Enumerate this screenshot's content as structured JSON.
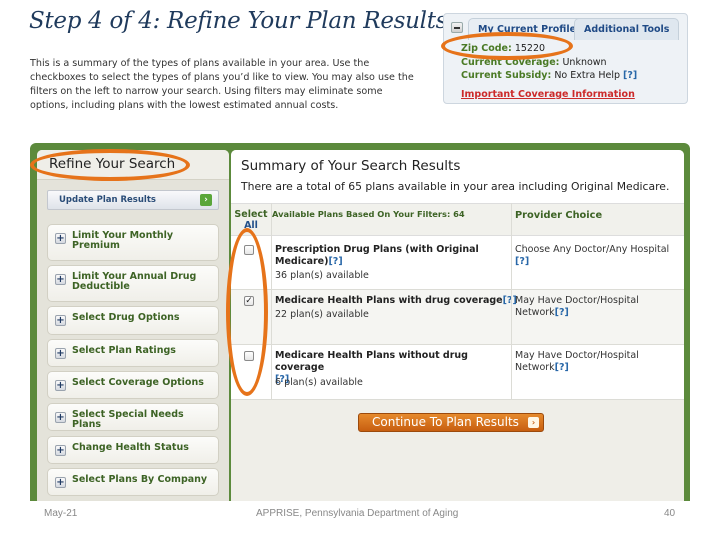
{
  "page": {
    "title": "Step 4 of 4: Refine Your Plan Results",
    "intro": "This is a summary of the types of plans available in your area. Use the checkboxes to select the types of plans you’d like to view. You may also use the filters on the left to narrow your search. Using filters may eliminate some options, including plans with the lowest estimated annual costs."
  },
  "profile": {
    "tabs": [
      {
        "label": "My Current Profile",
        "active": true
      },
      {
        "label": "Additional Tools",
        "active": false
      }
    ],
    "fields": [
      {
        "label": "Zip Code:",
        "value": "15220"
      },
      {
        "label": "Current Coverage:",
        "value": "Unknown"
      },
      {
        "label": "Current Subsidy:",
        "value": "No Extra Help",
        "help": "[?]"
      }
    ],
    "important_link": "Important Coverage Information"
  },
  "refine": {
    "title": "Refine Your Search",
    "update_button": "Update Plan Results",
    "filters": [
      "Limit Your Monthly Premium",
      "Limit Your Annual Drug Deductible",
      "Select Drug Options",
      "Select Plan Ratings",
      "Select Coverage Options",
      "Select Special Needs Plans",
      "Change Health Status",
      "Select Plans By Company"
    ]
  },
  "summary": {
    "title": "Summary of Your Search Results",
    "subtitle": "There are a total of 65 plans available in your area including Original Medicare.",
    "headers": {
      "select": "Select",
      "select_all": "All",
      "plans": "Available Plans Based On Your Filters:  64",
      "provider": "Provider Choice"
    },
    "rows": [
      {
        "name": "Prescription Drug Plans (with Original Medicare)",
        "help": "[?]",
        "count": "36 plan(s) available",
        "provider": "Choose Any Doctor/Any Hospital",
        "provider_help": "[?]",
        "checked": false
      },
      {
        "name": "Medicare Health Plans with drug coverage",
        "help": "[?]",
        "count": "22 plan(s) available",
        "provider": "May Have Doctor/Hospital Network",
        "provider_help": "[?]",
        "checked": true
      },
      {
        "name": "Medicare Health Plans without drug coverage",
        "help": "[?]",
        "count": "6 plan(s) available",
        "provider": "May Have Doctor/Hospital Network",
        "provider_help": "[?]",
        "checked": false
      }
    ],
    "continue_button": "Continue To Plan Results"
  },
  "footer": {
    "date": "May-21",
    "org": "APPRISE, Pennsylvania Department of Aging",
    "page": "40"
  },
  "colors": {
    "frame_green": "#5c8a3c",
    "annotation_orange": "#e6731a",
    "label_green": "#3d6325",
    "link_blue": "#2867a8",
    "button_orange": "#d16e1c",
    "title_navy": "#1f3a5c"
  }
}
